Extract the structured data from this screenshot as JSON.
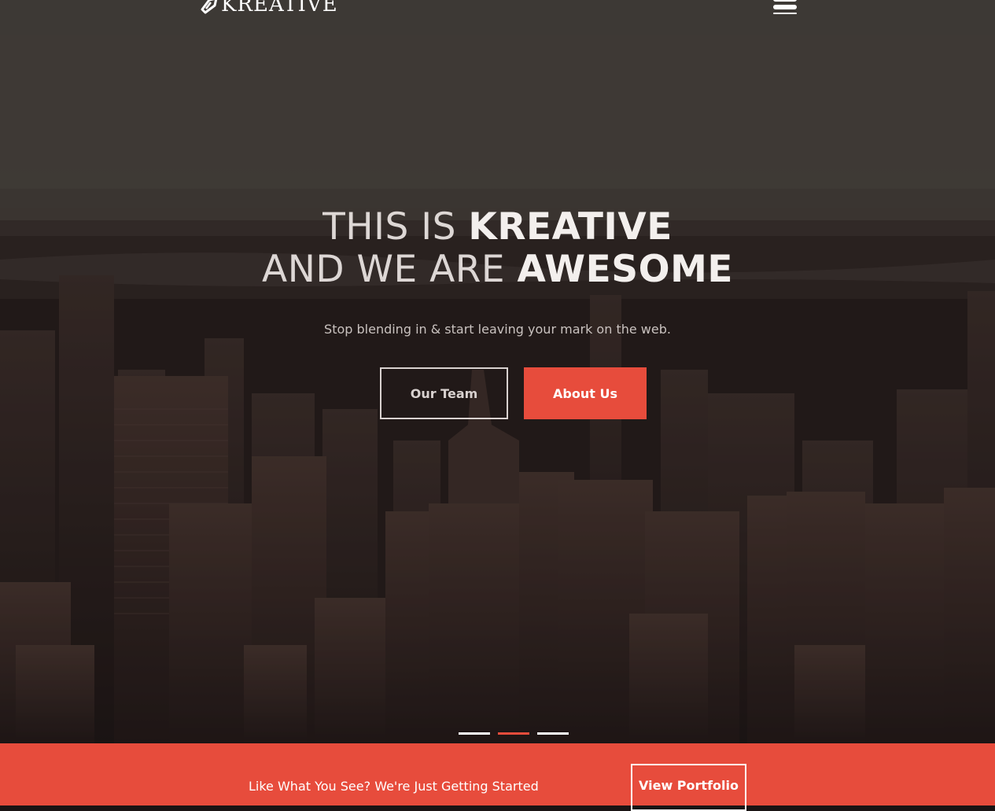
{
  "brand": {
    "name": "KREATIVE",
    "logo_icon": "pen-nib-icon"
  },
  "nav": {
    "menu_icon": "hamburger-menu-icon"
  },
  "hero": {
    "line1_light": "THIS IS ",
    "line1_bold": "KREATIVE",
    "line2_light": "AND WE ARE ",
    "line2_bold": "AWESOME",
    "subline": "Stop blending in & start leaving your mark on the web.",
    "buttons": {
      "our_team": "Our Team",
      "about_us": "About Us"
    },
    "slider": {
      "count": 3,
      "active_index": 1
    }
  },
  "cta": {
    "text": "Like What You See? We're Just Getting Started",
    "button": "View Portfolio"
  },
  "colors": {
    "accent": "#e74c3c",
    "text_light": "#ffffff"
  }
}
